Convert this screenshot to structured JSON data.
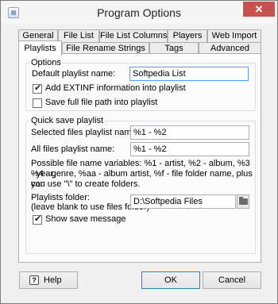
{
  "window": {
    "title": "Program Options",
    "close_glyph": "✕"
  },
  "tabs": {
    "row1": [
      "General",
      "File List",
      "File List Columns",
      "Players",
      "Web Import"
    ],
    "row2": [
      "Playlists",
      "File Rename Strings",
      "Tags",
      "Advanced"
    ],
    "active": "Playlists"
  },
  "options": {
    "title": "Options",
    "default_name_label": "Default playlist name:",
    "default_name_value": "Softpedia List",
    "extinf_label": "Add EXTINF information into playlist",
    "extinf_checked": true,
    "fullpath_label": "Save full file path into playlist",
    "fullpath_checked": false
  },
  "quick_save": {
    "title": "Quick save playlist",
    "selected_label": "Selected files playlist name:",
    "selected_value": "%1 - %2",
    "all_label": "All files playlist name:",
    "all_value": "%1 - %2",
    "hint_line1": "Possible file name variables: %1 - artist, %2 - album, %3 - year,",
    "hint_line2": "%4 - genre, %aa - album artist, %f - file folder name, plus you",
    "hint_line3": "can use \"\\\" to create folders.",
    "folder_label_line1": "Playlists folder:",
    "folder_label_line2": "(leave blank to use files folder)",
    "folder_value": "D:\\Softpedia Files",
    "show_message_label": "Show save message",
    "show_message_checked": true
  },
  "buttons": {
    "help": "Help",
    "ok": "OK",
    "cancel": "Cancel"
  },
  "icons": {
    "folder": "folder-icon",
    "help": "help-icon",
    "app": "app-icon"
  }
}
